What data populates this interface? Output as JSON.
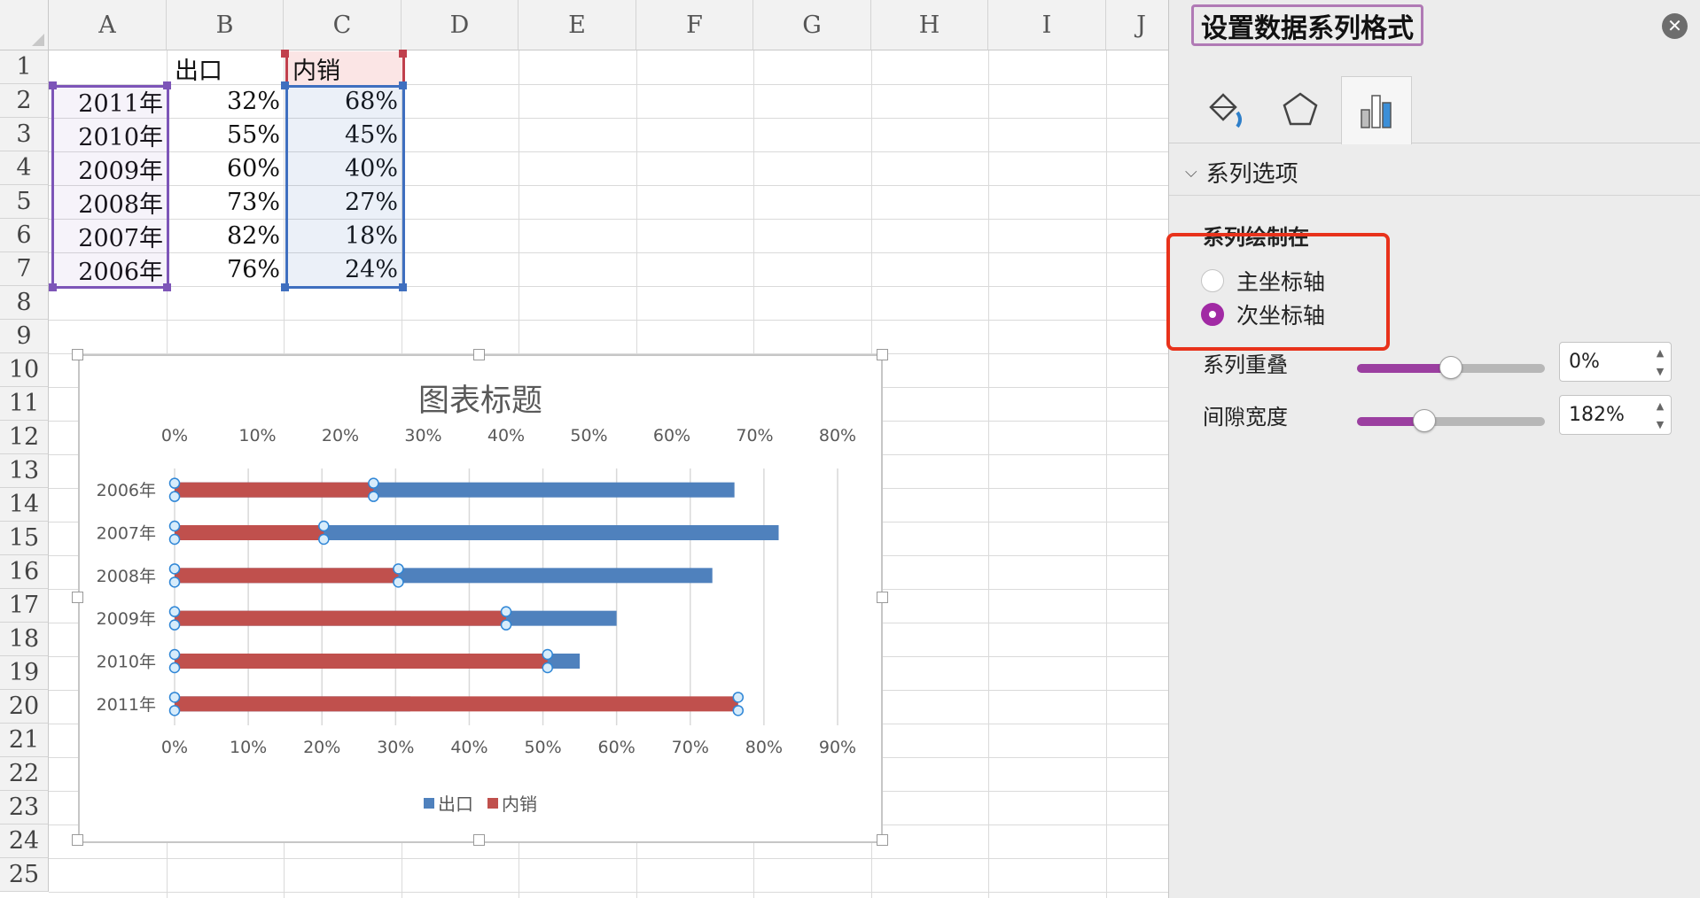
{
  "sheet": {
    "columns": [
      "A",
      "B",
      "C",
      "D",
      "E",
      "F",
      "G",
      "H",
      "I",
      "J"
    ],
    "rows": [
      "1",
      "2",
      "3",
      "4",
      "5",
      "6",
      "7",
      "8",
      "9",
      "10",
      "11",
      "12",
      "13",
      "14",
      "15",
      "16",
      "17",
      "18",
      "19",
      "20",
      "21",
      "22",
      "23",
      "24",
      "25"
    ],
    "headers": {
      "b1": "出口",
      "c1": "内销"
    },
    "data_rows": [
      {
        "year": "2011年",
        "export": "32%",
        "domestic": "68%"
      },
      {
        "year": "2010年",
        "export": "55%",
        "domestic": "45%"
      },
      {
        "year": "2009年",
        "export": "60%",
        "domestic": "40%"
      },
      {
        "year": "2008年",
        "export": "73%",
        "domestic": "27%"
      },
      {
        "year": "2007年",
        "export": "82%",
        "domestic": "18%"
      },
      {
        "year": "2006年",
        "export": "76%",
        "domestic": "24%"
      }
    ]
  },
  "chart_data": {
    "type": "bar",
    "title": "图表标题",
    "categories": [
      "2006年",
      "2007年",
      "2008年",
      "2009年",
      "2010年",
      "2011年"
    ],
    "series": [
      {
        "name": "出口",
        "color": "#4f81bd",
        "axis": "primary",
        "values": [
          0.76,
          0.82,
          0.73,
          0.6,
          0.55,
          0.32
        ]
      },
      {
        "name": "内销",
        "color": "#c0504d",
        "axis": "secondary",
        "values": [
          0.24,
          0.18,
          0.27,
          0.4,
          0.45,
          0.68
        ]
      }
    ],
    "primary_axis": {
      "ticks": [
        "0%",
        "10%",
        "20%",
        "30%",
        "40%",
        "50%",
        "60%",
        "70%",
        "80%",
        "90%"
      ],
      "range": [
        0,
        0.9
      ]
    },
    "secondary_axis": {
      "ticks": [
        "0%",
        "10%",
        "20%",
        "30%",
        "40%",
        "50%",
        "60%",
        "70%",
        "80%"
      ],
      "range": [
        0,
        0.8
      ]
    },
    "grid": true,
    "legend": "bottom",
    "selected_series": "内销"
  },
  "pane": {
    "title": "设置数据系列格式",
    "close_icon": "close-icon",
    "tabs": [
      "fill-line-icon",
      "effects-icon",
      "series-options-icon"
    ],
    "active_tab": 2,
    "section_label": "系列选项",
    "plot_on_label": "系列绘制在",
    "primary_axis_label": "主坐标轴",
    "secondary_axis_label": "次坐标轴",
    "selected_axis": "secondary",
    "overlap_label": "系列重叠",
    "overlap_value": "0%",
    "overlap_fraction": 0.5,
    "gap_label": "间隙宽度",
    "gap_value": "182%",
    "gap_fraction": 0.36,
    "accent_color": "#a12aa4",
    "highlight_color": "#e8321b"
  }
}
